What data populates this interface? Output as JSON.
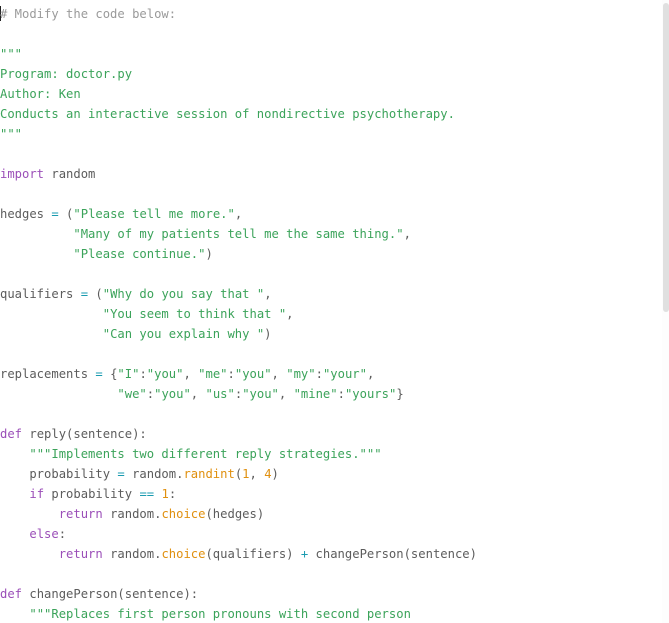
{
  "editor": {
    "language": "python",
    "colors": {
      "comment": "#9a9a9a",
      "string": "#3ba35a",
      "keyword": "#9b4fb8",
      "operator": "#1a9bb0",
      "function": "#e0900f",
      "number": "#e0900f",
      "plain": "#5c5c5c"
    },
    "lines": [
      [
        {
          "t": "comment",
          "v": "# Modify the code below:"
        }
      ],
      [],
      [
        {
          "t": "string",
          "v": "\"\"\""
        }
      ],
      [
        {
          "t": "string",
          "v": "Program: doctor.py"
        }
      ],
      [
        {
          "t": "string",
          "v": "Author: Ken"
        }
      ],
      [
        {
          "t": "string",
          "v": "Conducts an interactive session of nondirective psychotherapy."
        }
      ],
      [
        {
          "t": "string",
          "v": "\"\"\""
        }
      ],
      [],
      [
        {
          "t": "keyword",
          "v": "import"
        },
        {
          "t": "plain",
          "v": " random"
        }
      ],
      [],
      [
        {
          "t": "plain",
          "v": "hedges "
        },
        {
          "t": "op",
          "v": "="
        },
        {
          "t": "plain",
          "v": " ("
        },
        {
          "t": "string",
          "v": "\"Please tell me more.\""
        },
        {
          "t": "plain",
          "v": ","
        }
      ],
      [
        {
          "t": "plain",
          "v": "          "
        },
        {
          "t": "string",
          "v": "\"Many of my patients tell me the same thing.\""
        },
        {
          "t": "plain",
          "v": ","
        }
      ],
      [
        {
          "t": "plain",
          "v": "          "
        },
        {
          "t": "string",
          "v": "\"Please continue.\""
        },
        {
          "t": "plain",
          "v": ")"
        }
      ],
      [],
      [
        {
          "t": "plain",
          "v": "qualifiers "
        },
        {
          "t": "op",
          "v": "="
        },
        {
          "t": "plain",
          "v": " ("
        },
        {
          "t": "string",
          "v": "\"Why do you say that \""
        },
        {
          "t": "plain",
          "v": ","
        }
      ],
      [
        {
          "t": "plain",
          "v": "              "
        },
        {
          "t": "string",
          "v": "\"You seem to think that \""
        },
        {
          "t": "plain",
          "v": ","
        }
      ],
      [
        {
          "t": "plain",
          "v": "              "
        },
        {
          "t": "string",
          "v": "\"Can you explain why \""
        },
        {
          "t": "plain",
          "v": ")"
        }
      ],
      [],
      [
        {
          "t": "plain",
          "v": "replacements "
        },
        {
          "t": "op",
          "v": "="
        },
        {
          "t": "plain",
          "v": " {"
        },
        {
          "t": "string",
          "v": "\"I\""
        },
        {
          "t": "plain",
          "v": ":"
        },
        {
          "t": "string",
          "v": "\"you\""
        },
        {
          "t": "plain",
          "v": ", "
        },
        {
          "t": "string",
          "v": "\"me\""
        },
        {
          "t": "plain",
          "v": ":"
        },
        {
          "t": "string",
          "v": "\"you\""
        },
        {
          "t": "plain",
          "v": ", "
        },
        {
          "t": "string",
          "v": "\"my\""
        },
        {
          "t": "plain",
          "v": ":"
        },
        {
          "t": "string",
          "v": "\"your\""
        },
        {
          "t": "plain",
          "v": ","
        }
      ],
      [
        {
          "t": "plain",
          "v": "                "
        },
        {
          "t": "string",
          "v": "\"we\""
        },
        {
          "t": "plain",
          "v": ":"
        },
        {
          "t": "string",
          "v": "\"you\""
        },
        {
          "t": "plain",
          "v": ", "
        },
        {
          "t": "string",
          "v": "\"us\""
        },
        {
          "t": "plain",
          "v": ":"
        },
        {
          "t": "string",
          "v": "\"you\""
        },
        {
          "t": "plain",
          "v": ", "
        },
        {
          "t": "string",
          "v": "\"mine\""
        },
        {
          "t": "plain",
          "v": ":"
        },
        {
          "t": "string",
          "v": "\"yours\""
        },
        {
          "t": "plain",
          "v": "}"
        }
      ],
      [],
      [
        {
          "t": "keyword",
          "v": "def"
        },
        {
          "t": "plain",
          "v": " reply(sentence):"
        }
      ],
      [
        {
          "t": "plain",
          "v": "    "
        },
        {
          "t": "string",
          "v": "\"\"\"Implements two different reply strategies.\"\"\""
        }
      ],
      [
        {
          "t": "plain",
          "v": "    probability "
        },
        {
          "t": "op",
          "v": "="
        },
        {
          "t": "plain",
          "v": " random."
        },
        {
          "t": "func",
          "v": "randint"
        },
        {
          "t": "plain",
          "v": "("
        },
        {
          "t": "number",
          "v": "1"
        },
        {
          "t": "plain",
          "v": ", "
        },
        {
          "t": "number",
          "v": "4"
        },
        {
          "t": "plain",
          "v": ")"
        }
      ],
      [
        {
          "t": "plain",
          "v": "    "
        },
        {
          "t": "keyword",
          "v": "if"
        },
        {
          "t": "plain",
          "v": " probability "
        },
        {
          "t": "op",
          "v": "=="
        },
        {
          "t": "plain",
          "v": " "
        },
        {
          "t": "number",
          "v": "1"
        },
        {
          "t": "plain",
          "v": ":"
        }
      ],
      [
        {
          "t": "plain",
          "v": "        "
        },
        {
          "t": "keyword",
          "v": "return"
        },
        {
          "t": "plain",
          "v": " random."
        },
        {
          "t": "func",
          "v": "choice"
        },
        {
          "t": "plain",
          "v": "(hedges)"
        }
      ],
      [
        {
          "t": "plain",
          "v": "    "
        },
        {
          "t": "keyword",
          "v": "else"
        },
        {
          "t": "plain",
          "v": ":"
        }
      ],
      [
        {
          "t": "plain",
          "v": "        "
        },
        {
          "t": "keyword",
          "v": "return"
        },
        {
          "t": "plain",
          "v": " random."
        },
        {
          "t": "func",
          "v": "choice"
        },
        {
          "t": "plain",
          "v": "(qualifiers) "
        },
        {
          "t": "op",
          "v": "+"
        },
        {
          "t": "plain",
          "v": " changePerson(sentence)"
        }
      ],
      [],
      [
        {
          "t": "keyword",
          "v": "def"
        },
        {
          "t": "plain",
          "v": " changePerson(sentence):"
        }
      ],
      [
        {
          "t": "plain",
          "v": "    "
        },
        {
          "t": "string",
          "v": "\"\"\"Replaces first person pronouns with second person"
        }
      ]
    ]
  }
}
